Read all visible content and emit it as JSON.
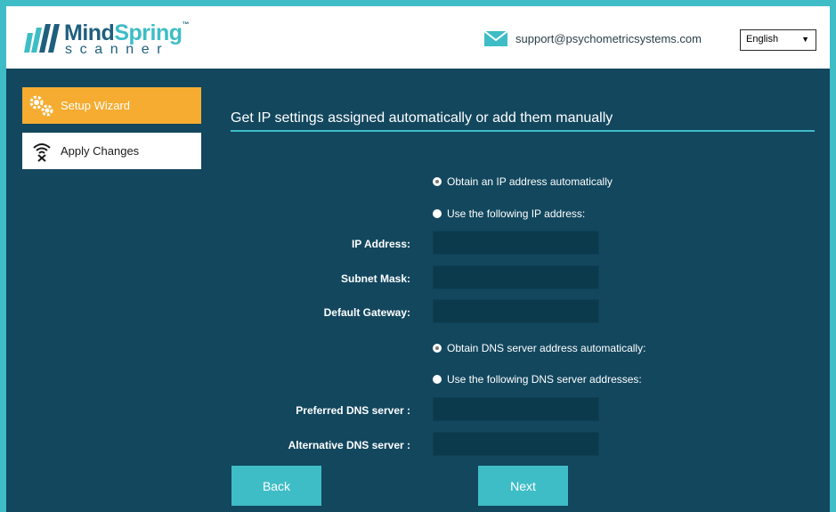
{
  "brand": {
    "name_primary": "Mind",
    "name_accent": "Spring",
    "trademark": "™",
    "subtitle": "scanner",
    "colors": {
      "teal": "#3ebdc6",
      "navy": "#1f5f7e",
      "orange": "#f5ac30",
      "panel": "#12475e"
    }
  },
  "header": {
    "support_icon": "envelope-icon",
    "support_email": "support@psychometricsystems.com",
    "language": {
      "selected": "English",
      "arrow": "▼"
    }
  },
  "sidebar": {
    "items": [
      {
        "label": "Setup Wizard",
        "icon": "gears-icon",
        "active": true
      },
      {
        "label": "Apply Changes",
        "icon": "wifi-off-icon",
        "active": false
      }
    ]
  },
  "content": {
    "title": "Get IP settings assigned automatically or add them manually",
    "ip_options": [
      {
        "label": "Obtain an IP address automatically",
        "checked": true
      },
      {
        "label": "Use the following IP address:",
        "checked": false
      }
    ],
    "ip_fields": [
      {
        "label": "IP Address:",
        "value": ""
      },
      {
        "label": "Subnet Mask:",
        "value": ""
      },
      {
        "label": "Default Gateway:",
        "value": ""
      }
    ],
    "dns_options": [
      {
        "label": "Obtain DNS server address automatically:",
        "checked": true
      },
      {
        "label": "Use the following DNS server addresses:",
        "checked": false
      }
    ],
    "dns_fields": [
      {
        "label": "Preferred DNS server :",
        "value": ""
      },
      {
        "label": "Alternative DNS server :",
        "value": ""
      }
    ]
  },
  "buttons": {
    "back": "Back",
    "next": "Next"
  }
}
